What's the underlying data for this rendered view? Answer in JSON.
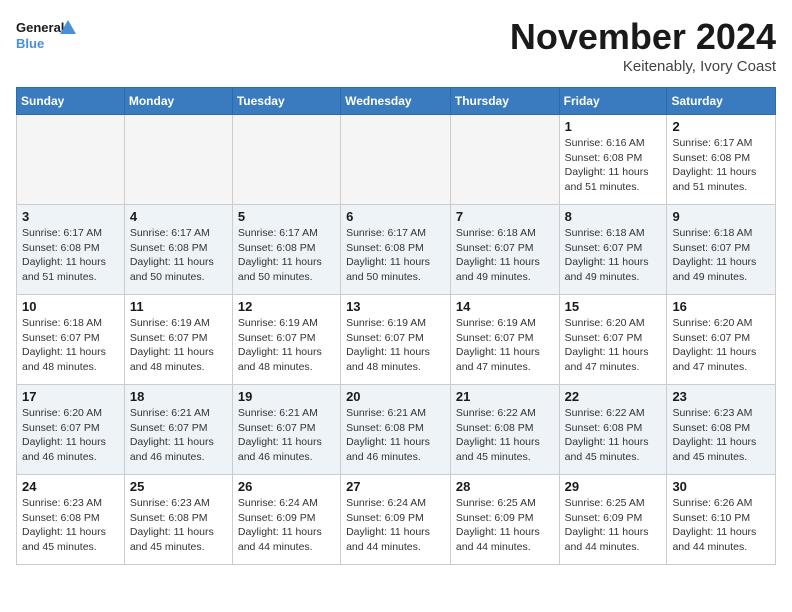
{
  "header": {
    "logo_line1": "General",
    "logo_line2": "Blue",
    "month_title": "November 2024",
    "location": "Keitenably, Ivory Coast"
  },
  "weekdays": [
    "Sunday",
    "Monday",
    "Tuesday",
    "Wednesday",
    "Thursday",
    "Friday",
    "Saturday"
  ],
  "weeks": [
    [
      {
        "day": "",
        "info": ""
      },
      {
        "day": "",
        "info": ""
      },
      {
        "day": "",
        "info": ""
      },
      {
        "day": "",
        "info": ""
      },
      {
        "day": "",
        "info": ""
      },
      {
        "day": "1",
        "info": "Sunrise: 6:16 AM\nSunset: 6:08 PM\nDaylight: 11 hours and 51 minutes."
      },
      {
        "day": "2",
        "info": "Sunrise: 6:17 AM\nSunset: 6:08 PM\nDaylight: 11 hours and 51 minutes."
      }
    ],
    [
      {
        "day": "3",
        "info": "Sunrise: 6:17 AM\nSunset: 6:08 PM\nDaylight: 11 hours and 51 minutes."
      },
      {
        "day": "4",
        "info": "Sunrise: 6:17 AM\nSunset: 6:08 PM\nDaylight: 11 hours and 50 minutes."
      },
      {
        "day": "5",
        "info": "Sunrise: 6:17 AM\nSunset: 6:08 PM\nDaylight: 11 hours and 50 minutes."
      },
      {
        "day": "6",
        "info": "Sunrise: 6:17 AM\nSunset: 6:08 PM\nDaylight: 11 hours and 50 minutes."
      },
      {
        "day": "7",
        "info": "Sunrise: 6:18 AM\nSunset: 6:07 PM\nDaylight: 11 hours and 49 minutes."
      },
      {
        "day": "8",
        "info": "Sunrise: 6:18 AM\nSunset: 6:07 PM\nDaylight: 11 hours and 49 minutes."
      },
      {
        "day": "9",
        "info": "Sunrise: 6:18 AM\nSunset: 6:07 PM\nDaylight: 11 hours and 49 minutes."
      }
    ],
    [
      {
        "day": "10",
        "info": "Sunrise: 6:18 AM\nSunset: 6:07 PM\nDaylight: 11 hours and 48 minutes."
      },
      {
        "day": "11",
        "info": "Sunrise: 6:19 AM\nSunset: 6:07 PM\nDaylight: 11 hours and 48 minutes."
      },
      {
        "day": "12",
        "info": "Sunrise: 6:19 AM\nSunset: 6:07 PM\nDaylight: 11 hours and 48 minutes."
      },
      {
        "day": "13",
        "info": "Sunrise: 6:19 AM\nSunset: 6:07 PM\nDaylight: 11 hours and 48 minutes."
      },
      {
        "day": "14",
        "info": "Sunrise: 6:19 AM\nSunset: 6:07 PM\nDaylight: 11 hours and 47 minutes."
      },
      {
        "day": "15",
        "info": "Sunrise: 6:20 AM\nSunset: 6:07 PM\nDaylight: 11 hours and 47 minutes."
      },
      {
        "day": "16",
        "info": "Sunrise: 6:20 AM\nSunset: 6:07 PM\nDaylight: 11 hours and 47 minutes."
      }
    ],
    [
      {
        "day": "17",
        "info": "Sunrise: 6:20 AM\nSunset: 6:07 PM\nDaylight: 11 hours and 46 minutes."
      },
      {
        "day": "18",
        "info": "Sunrise: 6:21 AM\nSunset: 6:07 PM\nDaylight: 11 hours and 46 minutes."
      },
      {
        "day": "19",
        "info": "Sunrise: 6:21 AM\nSunset: 6:07 PM\nDaylight: 11 hours and 46 minutes."
      },
      {
        "day": "20",
        "info": "Sunrise: 6:21 AM\nSunset: 6:08 PM\nDaylight: 11 hours and 46 minutes."
      },
      {
        "day": "21",
        "info": "Sunrise: 6:22 AM\nSunset: 6:08 PM\nDaylight: 11 hours and 45 minutes."
      },
      {
        "day": "22",
        "info": "Sunrise: 6:22 AM\nSunset: 6:08 PM\nDaylight: 11 hours and 45 minutes."
      },
      {
        "day": "23",
        "info": "Sunrise: 6:23 AM\nSunset: 6:08 PM\nDaylight: 11 hours and 45 minutes."
      }
    ],
    [
      {
        "day": "24",
        "info": "Sunrise: 6:23 AM\nSunset: 6:08 PM\nDaylight: 11 hours and 45 minutes."
      },
      {
        "day": "25",
        "info": "Sunrise: 6:23 AM\nSunset: 6:08 PM\nDaylight: 11 hours and 45 minutes."
      },
      {
        "day": "26",
        "info": "Sunrise: 6:24 AM\nSunset: 6:09 PM\nDaylight: 11 hours and 44 minutes."
      },
      {
        "day": "27",
        "info": "Sunrise: 6:24 AM\nSunset: 6:09 PM\nDaylight: 11 hours and 44 minutes."
      },
      {
        "day": "28",
        "info": "Sunrise: 6:25 AM\nSunset: 6:09 PM\nDaylight: 11 hours and 44 minutes."
      },
      {
        "day": "29",
        "info": "Sunrise: 6:25 AM\nSunset: 6:09 PM\nDaylight: 11 hours and 44 minutes."
      },
      {
        "day": "30",
        "info": "Sunrise: 6:26 AM\nSunset: 6:10 PM\nDaylight: 11 hours and 44 minutes."
      }
    ]
  ]
}
